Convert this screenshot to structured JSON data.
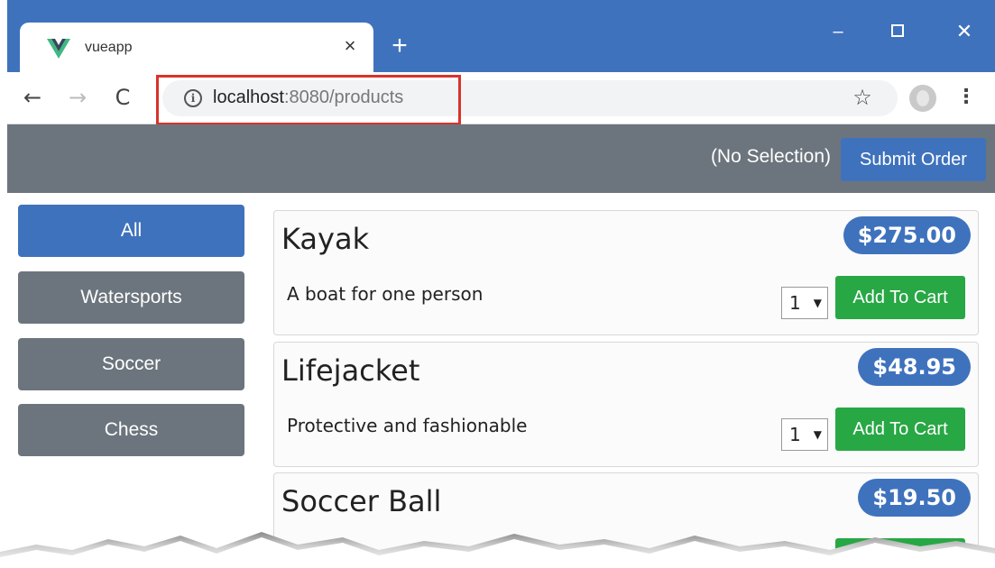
{
  "browser": {
    "tab_title": "vueapp",
    "tab_close": "×",
    "new_tab": "+",
    "url_host": "localhost",
    "url_rest": ":8080/products",
    "info_glyph": "i",
    "star_glyph": "☆",
    "menu_glyph": "⋮",
    "back_glyph": "←",
    "forward_glyph": "→",
    "reload_glyph": "C",
    "minimize_glyph": "–",
    "close_glyph": "✕"
  },
  "header": {
    "selection": "(No Selection)",
    "submit_label": "Submit Order"
  },
  "categories": [
    {
      "label": "All",
      "active": true
    },
    {
      "label": "Watersports",
      "active": false
    },
    {
      "label": "Soccer",
      "active": false
    },
    {
      "label": "Chess",
      "active": false
    }
  ],
  "products": [
    {
      "name": "Kayak",
      "price": "$275.00",
      "description": "A boat for one person",
      "quantity": "1",
      "cart_label": "Add To Cart"
    },
    {
      "name": "Lifejacket",
      "price": "$48.95",
      "description": "Protective and fashionable",
      "quantity": "1",
      "cart_label": "Add To Cart"
    },
    {
      "name": "Soccer Ball",
      "price": "$19.50",
      "description": "",
      "quantity": "",
      "cart_label": ""
    }
  ],
  "colors": {
    "titlebar": "#3f72bd",
    "primary": "#3f72bd",
    "secondary": "#6c757d",
    "success": "#28a745",
    "highlight": "#d9332b"
  }
}
